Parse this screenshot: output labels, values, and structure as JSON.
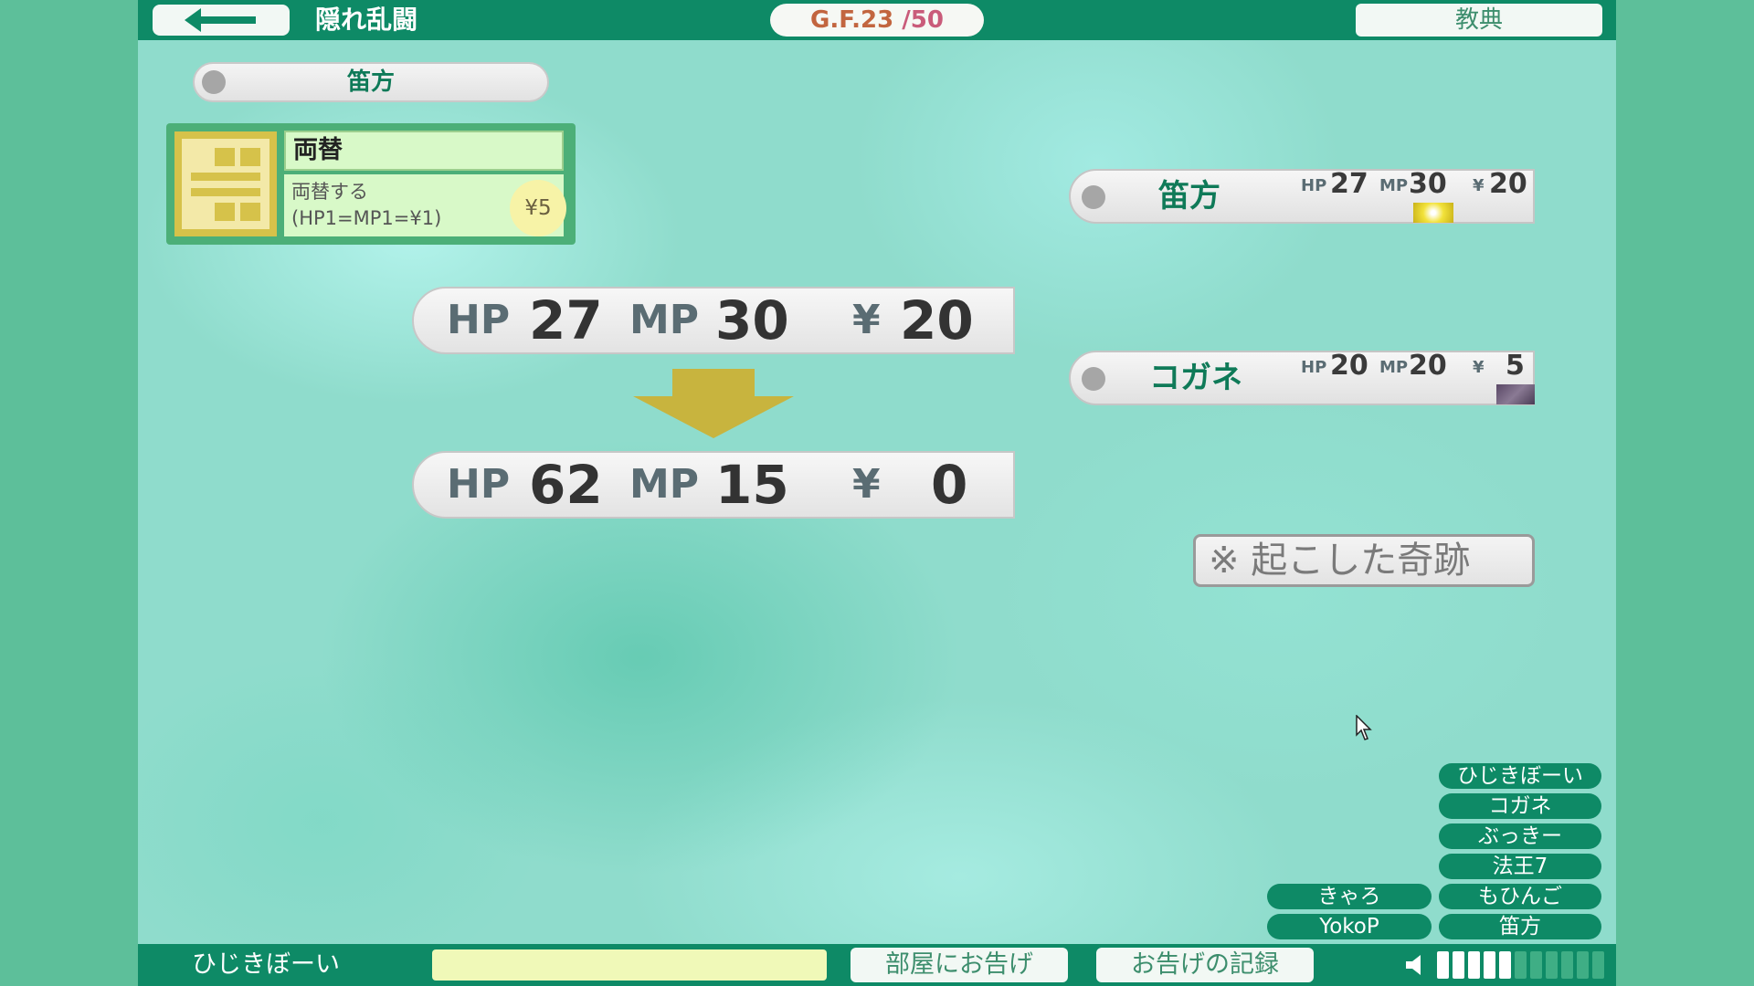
{
  "header": {
    "back_icon": "left-arrow-icon",
    "room_title": "隠れ乱闘",
    "gf_label": "G.F.",
    "gf_current": "23",
    "gf_max": "/50",
    "scripture_button": "教典"
  },
  "current_player_tab": {
    "name": "笛方"
  },
  "skill_card": {
    "icon": "exchange-glyph-icon",
    "name": "両替",
    "desc_line1": "両替する",
    "desc_line2": "(HP1=MP1=¥1)",
    "cost": "¥5"
  },
  "stats_before": {
    "hp_label": "HP",
    "hp": "27",
    "mp_label": "MP",
    "mp": "30",
    "yen_label": "¥",
    "yen": "20"
  },
  "stats_after": {
    "hp_label": "HP",
    "hp": "62",
    "mp_label": "MP",
    "mp": "15",
    "yen_label": "¥",
    "yen": "0"
  },
  "players": [
    {
      "name": "笛方",
      "hp_label": "HP",
      "hp": "27",
      "mp_label": "MP",
      "mp": "30",
      "yen_label": "¥",
      "yen": "20",
      "badge_color": "#f2e23a"
    },
    {
      "name": "コガネ",
      "hp_label": "HP",
      "hp": "20",
      "mp_label": "MP",
      "mp": "20",
      "yen_label": "¥",
      "yen": "5",
      "badge_color": "#6b5a72"
    }
  ],
  "miracle_button": "※ 起こした奇跡",
  "member_chips": {
    "right": [
      "ひじきぼーい",
      "コガネ",
      "ぶっきー",
      "法王7",
      "もひんご",
      "笛方"
    ],
    "left": [
      "きゃろ",
      "YokoP"
    ]
  },
  "footer": {
    "username": "ひじきぼーい",
    "message_input_placeholder": "",
    "announce_button": "部屋にお告げ",
    "log_button": "お告げの記録",
    "volume_icon": "speaker-icon",
    "volume_level": 5,
    "volume_max": 11
  },
  "colors": {
    "bar_green": "#0e8a66",
    "name_green": "#0f7a58",
    "card_gold": "#d6c24a",
    "arrow_gold": "#c8b43e"
  }
}
